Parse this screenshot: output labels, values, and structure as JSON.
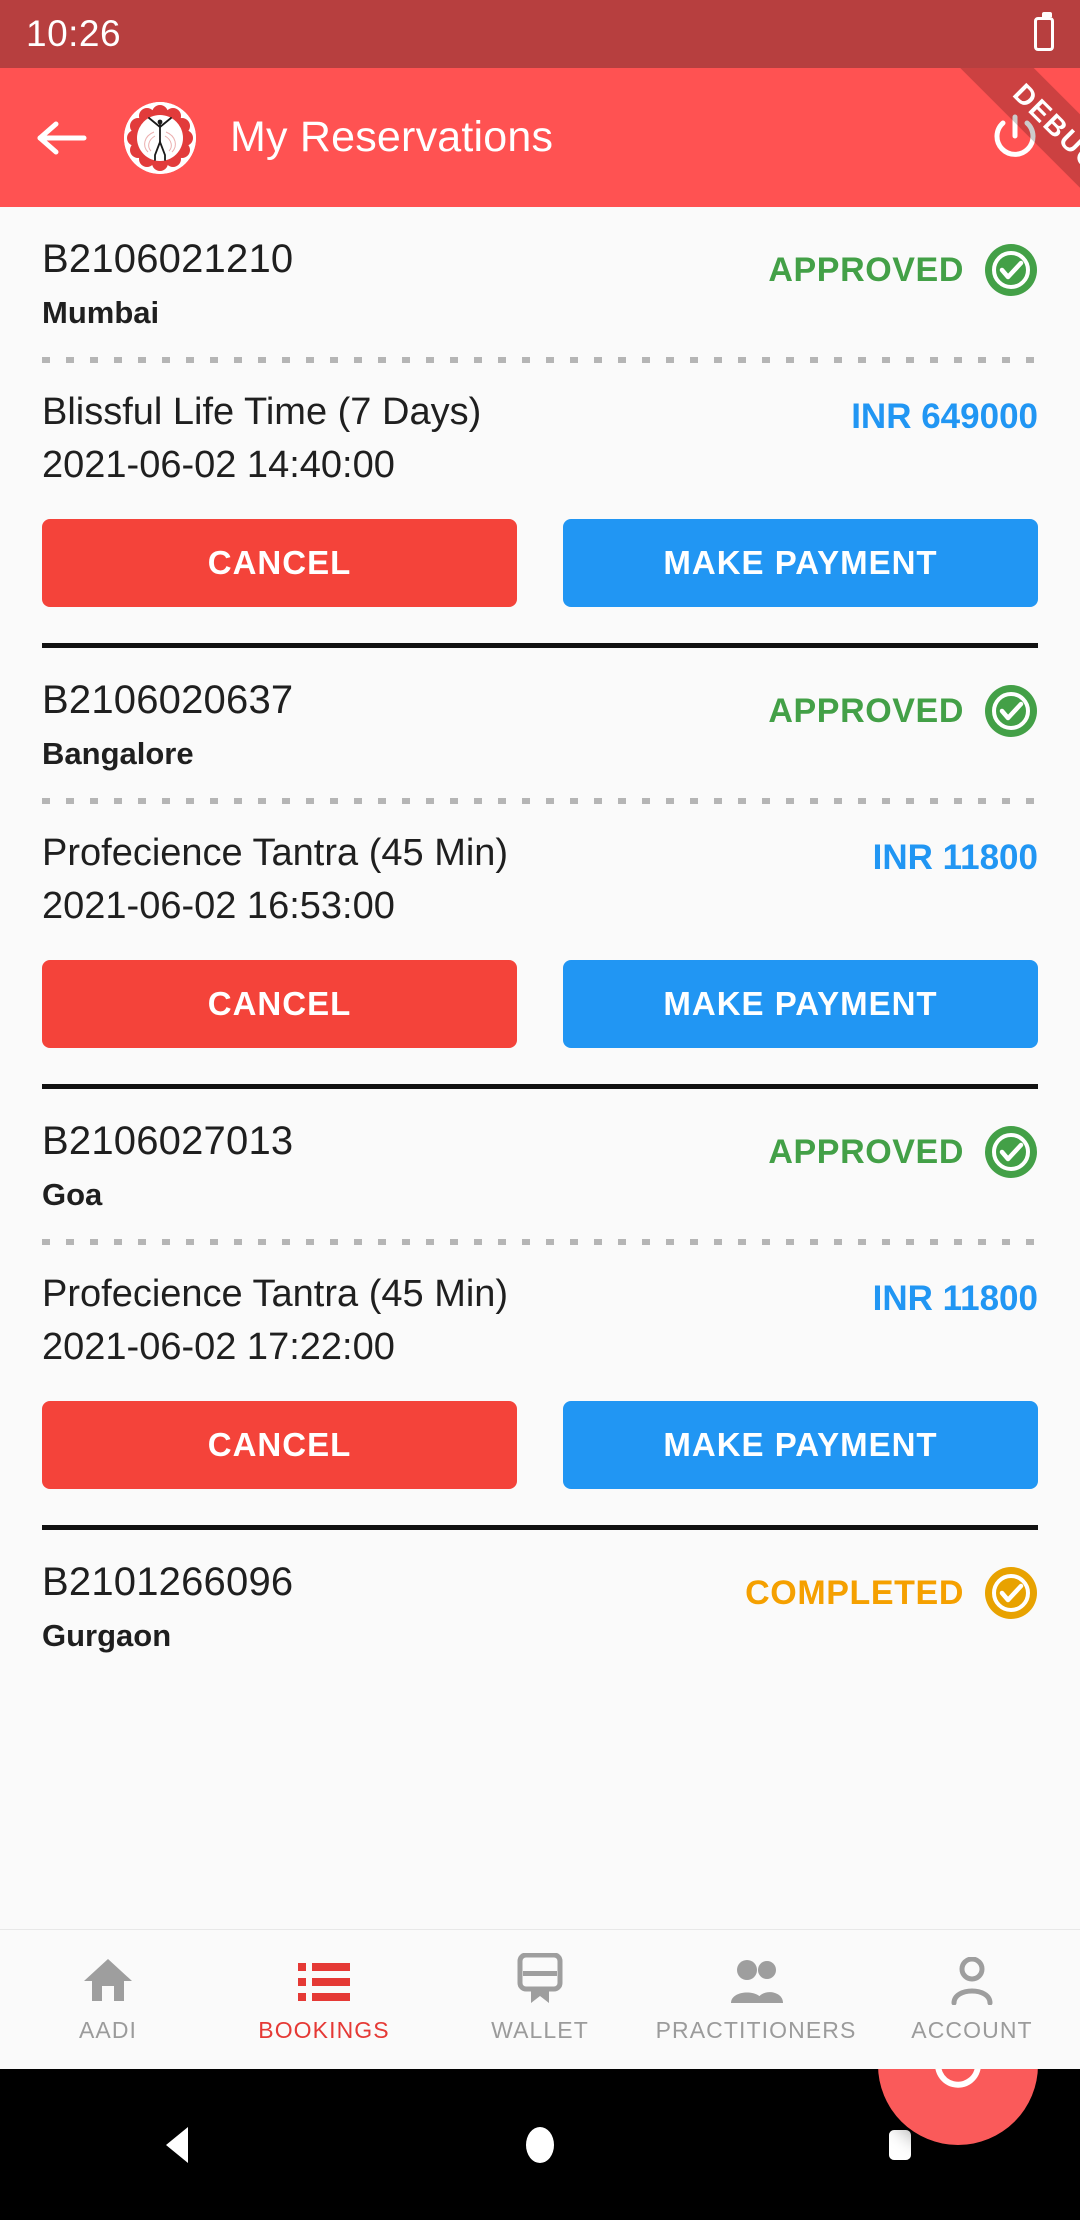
{
  "statusbar": {
    "time": "10:26",
    "battery_icon": "battery-icon"
  },
  "debug_ribbon": {
    "label": "DEBUG"
  },
  "appbar": {
    "title": "My Reservations",
    "back_icon": "back-arrow-icon",
    "logo_icon": "app-logo-icon",
    "power_icon": "power-icon",
    "background": "#FF5252"
  },
  "colors": {
    "primary": "#FF5252",
    "status_bar": "#B73F3F",
    "approved": "#43A047",
    "completed": "#F5A000",
    "price": "#2196F3",
    "cancel_button": "#F4433A",
    "pay_button": "#2196F3",
    "fab": "#FA5A5A"
  },
  "bookings": [
    {
      "booking_id": "B2106021210",
      "city": "Mumbai",
      "status": "APPROVED",
      "status_kind": "approved",
      "service": "Blissful Life Time (7 Days)",
      "datetime": "2021-06-02 14:40:00",
      "price": "INR 649000",
      "cancel_label": "CANCEL",
      "pay_label": "MAKE PAYMENT"
    },
    {
      "booking_id": "B2106020637",
      "city": "Bangalore",
      "status": "APPROVED",
      "status_kind": "approved",
      "service": "Profecience Tantra (45 Min)",
      "datetime": "2021-06-02 16:53:00",
      "price": "INR 11800",
      "cancel_label": "CANCEL",
      "pay_label": "MAKE PAYMENT"
    },
    {
      "booking_id": "B2106027013",
      "city": "Goa",
      "status": "APPROVED",
      "status_kind": "approved",
      "service": "Profecience Tantra (45 Min)",
      "datetime": "2021-06-02 17:22:00",
      "price": "INR 11800",
      "cancel_label": "CANCEL",
      "pay_label": "MAKE PAYMENT"
    },
    {
      "booking_id": "B2101266096",
      "city": "Gurgaon",
      "status": "COMPLETED",
      "status_kind": "completed",
      "service": "",
      "datetime": "",
      "price": "",
      "cancel_label": "",
      "pay_label": ""
    }
  ],
  "fab": {
    "icon": "refresh-icon"
  },
  "bottom_nav": {
    "items": [
      {
        "label": "AADI",
        "icon": "home-icon",
        "active": false
      },
      {
        "label": "BOOKINGS",
        "icon": "list-icon",
        "active": true
      },
      {
        "label": "WALLET",
        "icon": "ticket-icon",
        "active": false
      },
      {
        "label": "PRACTITIONERS",
        "icon": "people-icon",
        "active": false
      },
      {
        "label": "ACCOUNT",
        "icon": "person-icon",
        "active": false
      }
    ]
  },
  "android_nav": {
    "back_icon": "android-back-icon",
    "home_icon": "android-home-icon",
    "recents_icon": "android-recents-icon"
  }
}
